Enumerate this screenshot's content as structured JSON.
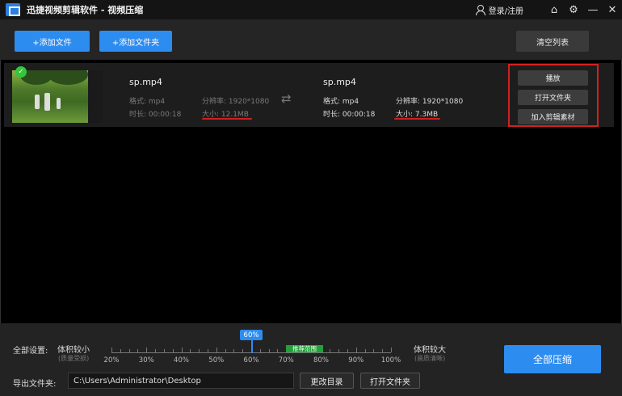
{
  "window": {
    "title": "迅捷视频剪辑软件 - 视频压缩",
    "login_label": "登录/注册",
    "icons": [
      "user-icon",
      "home-icon",
      "settings-icon",
      "minimize-icon",
      "close-icon"
    ]
  },
  "toolbar": {
    "add_file": "+添加文件",
    "add_folder": "+添加文件夹",
    "clear_list": "清空列表"
  },
  "files": [
    {
      "source": {
        "name": "sp.mp4",
        "format": "格式: mp4",
        "duration": "时长: 00:00:18",
        "resolution": "分辨率: 1920*1080",
        "size": "大小: 12.1MB"
      },
      "output": {
        "name": "sp.mp4",
        "format": "格式: mp4",
        "duration": "时长: 00:00:18",
        "resolution": "分辨率: 1920*1080",
        "size": "大小: 7.3MB"
      },
      "actions": {
        "play": "播放",
        "open_folder": "打开文件夹",
        "add_to_edit": "加入剪辑素材"
      }
    }
  ],
  "settings": {
    "global_label": "全部设置:",
    "small_label": "体积较小",
    "small_sub": "(质量受损)",
    "big_label": "体积较大",
    "big_sub": "(画质清晰)",
    "slider_value": 60,
    "slider_value_label": "60%",
    "recommended_label": "推荐范围",
    "ticks": [
      "20%",
      "30%",
      "40%",
      "50%",
      "60%",
      "70%",
      "80%",
      "90%",
      "100%"
    ]
  },
  "export": {
    "label": "导出文件夹:",
    "path": "C:\\Users\\Administrator\\Desktop",
    "change_dir": "更改目录",
    "open_folder": "打开文件夹"
  },
  "compress_all": "全部压缩",
  "colors": {
    "accent": "#2d8cf0",
    "highlight_red": "#d42020",
    "recommended_green": "#22a03a"
  }
}
